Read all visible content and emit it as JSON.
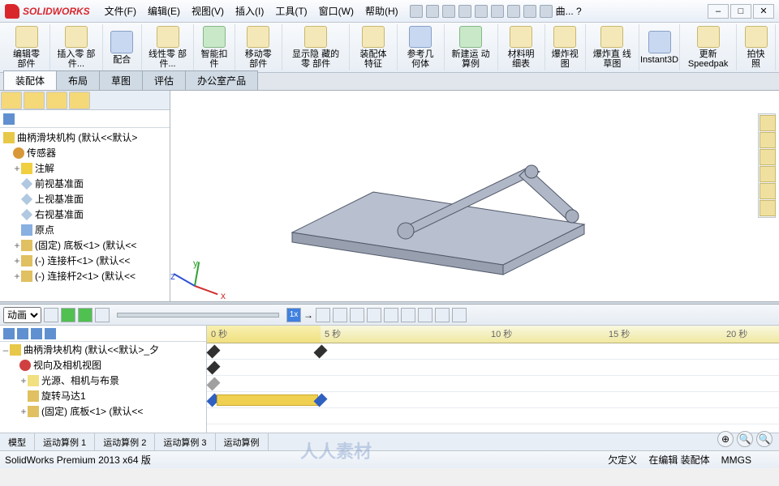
{
  "app": {
    "name": "SOLIDWORKS"
  },
  "menu": [
    "文件(F)",
    "编辑(E)",
    "视图(V)",
    "插入(I)",
    "工具(T)",
    "窗口(W)",
    "帮助(H)"
  ],
  "menu_extra": "曲... ?",
  "ribbon": [
    {
      "label": "编辑零\n部件"
    },
    {
      "label": "插入零\n部件..."
    },
    {
      "label": "配合"
    },
    {
      "label": "线性零\n部件..."
    },
    {
      "label": "智能扣\n件"
    },
    {
      "label": "移动零\n部件"
    },
    {
      "label": "显示隐\n藏的零\n部件"
    },
    {
      "label": "装配体\n特征"
    },
    {
      "label": "参考几\n何体"
    },
    {
      "label": "新建运\n动算例"
    },
    {
      "label": "材料明\n细表"
    },
    {
      "label": "爆炸视\n图"
    },
    {
      "label": "爆炸直\n线草图"
    },
    {
      "label": "Instant3D"
    },
    {
      "label": "更新\nSpeedpak"
    },
    {
      "label": "拍快照"
    }
  ],
  "tabs": [
    "装配体",
    "布局",
    "草图",
    "评估",
    "办公室产品"
  ],
  "feature_tree": {
    "root": "曲柄滑块机构  (默认<<默认>",
    "items": [
      {
        "icon": "sens",
        "label": "传感器"
      },
      {
        "icon": "ann",
        "label": "注解",
        "exp": "+"
      },
      {
        "icon": "plane",
        "label": "前视基准面"
      },
      {
        "icon": "plane",
        "label": "上视基准面"
      },
      {
        "icon": "plane",
        "label": "右视基准面"
      },
      {
        "icon": "orig",
        "label": "原点"
      },
      {
        "icon": "part",
        "label": "(固定) 底板<1> (默认<<",
        "exp": "+"
      },
      {
        "icon": "part",
        "label": "(-) 连接杆<1> (默认<<",
        "exp": "+"
      },
      {
        "icon": "part",
        "label": "(-) 连接杆2<1> (默认<<",
        "exp": "+"
      }
    ]
  },
  "motion": {
    "type": "动画",
    "speed": "1x",
    "ruler": [
      {
        "pos": 5,
        "label": "0 秒"
      },
      {
        "pos": 145,
        "label": "5 秒"
      },
      {
        "pos": 350,
        "label": "10 秒"
      },
      {
        "pos": 495,
        "label": "15 秒"
      },
      {
        "pos": 640,
        "label": "20 秒"
      }
    ],
    "tree": [
      {
        "icon": "asm",
        "label": "曲柄滑块机构  (默认<<默认>_夕"
      },
      {
        "icon": "orient",
        "label": "视向及相机视图"
      },
      {
        "icon": "light",
        "label": "光源、相机与布景",
        "exp": "+"
      },
      {
        "icon": "motor",
        "label": "旋转马达1"
      },
      {
        "icon": "part",
        "label": "(固定) 底板<1> (默认<<",
        "exp": "+"
      }
    ],
    "tabs": [
      "模型",
      "运动算例 1",
      "运动算例 2",
      "运动算例 3",
      "运动算例"
    ]
  },
  "status": {
    "left": "SolidWorks Premium 2013 x64 版",
    "right": [
      "欠定义",
      "在编辑 装配体",
      "MMGS"
    ]
  },
  "triad": {
    "x": "x",
    "y": "y",
    "z": "z"
  },
  "watermark": "人人素材"
}
